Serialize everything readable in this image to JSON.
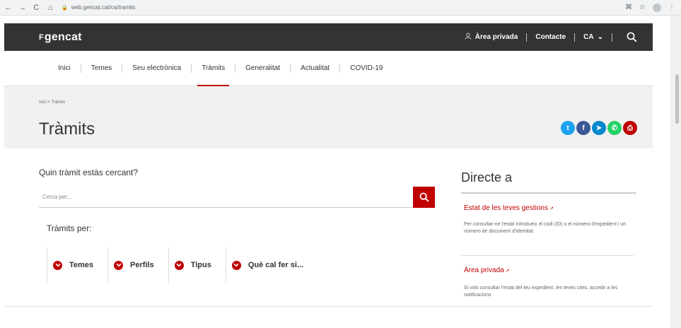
{
  "browser": {
    "url": "web.gencat.cat/ca/tramits",
    "back_icon": "←",
    "forward_icon": "→",
    "reload_icon": "C",
    "home_icon": "⌂",
    "ext_icon": "⌘",
    "star_icon": "☆",
    "menu_icon": "⋮"
  },
  "header": {
    "logo_mark": "F",
    "logo_text": "gencat",
    "area_privada": "Àrea privada",
    "contacte": "Contacte",
    "lang": "CA",
    "lang_chevron": "⌄"
  },
  "nav": {
    "items": [
      "Inici",
      "Temes",
      "Seu electrònica",
      "Tràmits",
      "Generalitat",
      "Actualitat",
      "COVID-19"
    ]
  },
  "page": {
    "breadcrumb": "Inici > Tràmits",
    "title": "Tràmits"
  },
  "social": {
    "twitter": "t",
    "facebook": "f",
    "telegram": "➤",
    "whatsapp": "✆",
    "print": "⎙",
    "colors": [
      "#1da1f2",
      "#3b5998",
      "#0088cc",
      "#25d366",
      "#c00000"
    ]
  },
  "search": {
    "question": "Quin tràmit estàs cercant?",
    "placeholder": "Cerca per..."
  },
  "tramits_per": {
    "label": "Tràmits per:",
    "tabs": [
      "Temes",
      "Perfils",
      "Tipus",
      "Què cal fer si..."
    ]
  },
  "directe": {
    "title": "Directe a",
    "links": [
      {
        "label": "Estat de les teves gestions",
        "desc": "Per consultar-ne l'estat introdueix el codi (ID) o el número d'expedient i un número de document d'identitat."
      },
      {
        "label": "Àrea privada",
        "desc": "Si vols consultar l'estat del teu expedient, les teves cites, accedir a les notificacions"
      }
    ]
  },
  "colors": {
    "accent": "#c00000",
    "topbar": "#333333"
  }
}
